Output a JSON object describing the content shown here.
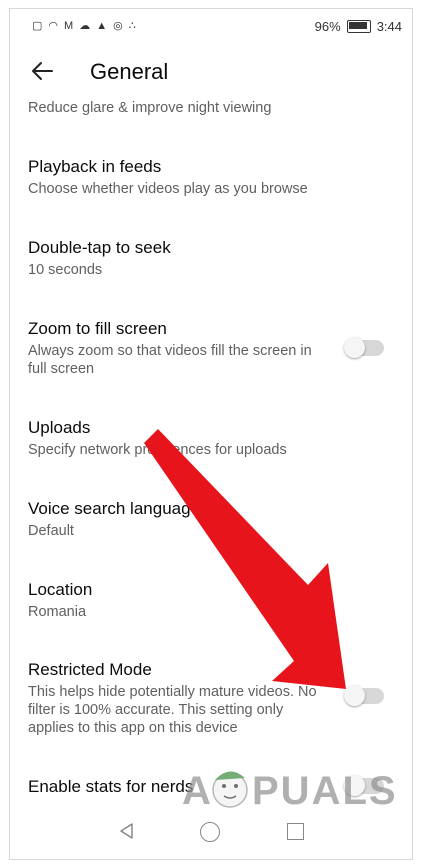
{
  "status_bar": {
    "battery": "96%",
    "time": "3:44"
  },
  "header": {
    "title": "General"
  },
  "settings": [
    {
      "title": "",
      "subtitle": "Reduce glare & improve night viewing"
    },
    {
      "title": "Playback in feeds",
      "subtitle": "Choose whether videos play as you browse"
    },
    {
      "title": "Double-tap to seek",
      "subtitle": "10 seconds"
    },
    {
      "title": "Zoom to fill screen",
      "subtitle": "Always zoom so that videos fill the screen in full screen",
      "toggle": false
    },
    {
      "title": "Uploads",
      "subtitle": "Specify network preferences for uploads"
    },
    {
      "title": "Voice search language",
      "subtitle": "Default"
    },
    {
      "title": "Location",
      "subtitle": "Romania"
    },
    {
      "title": "Restricted Mode",
      "subtitle": "This helps hide potentially mature videos. No filter is 100% accurate. This setting only applies to this app on this device",
      "toggle": false
    },
    {
      "title": "Enable stats for nerds",
      "subtitle": "",
      "toggle": false
    }
  ],
  "watermark": {
    "text": "APPUALS"
  },
  "icons": {
    "back": "arrow-left-icon",
    "arrow": "red-arrow-icon"
  },
  "colors": {
    "arrow": "#e8141c",
    "toggle_track": "#d7d7d7"
  }
}
